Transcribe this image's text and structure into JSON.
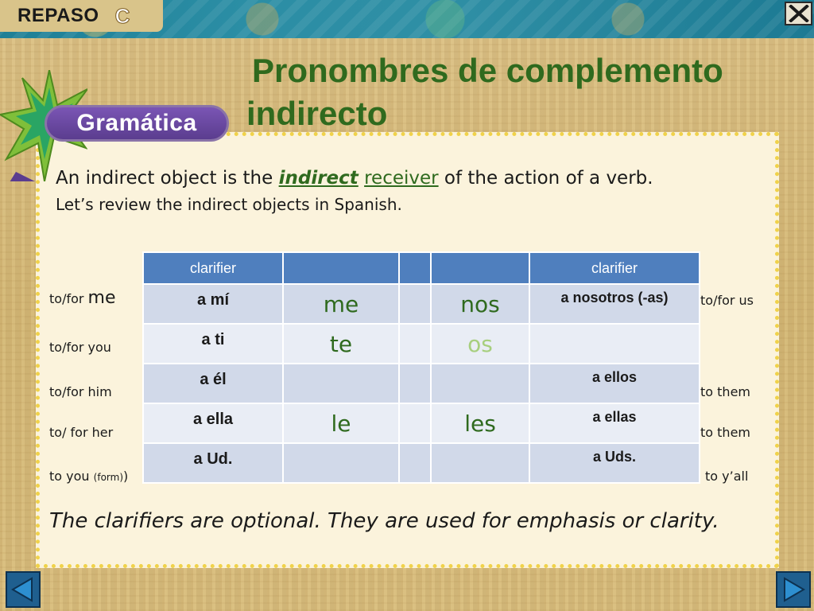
{
  "banner": {
    "label": "REPASO",
    "letter": "C",
    "close_icon": "close-x-icon"
  },
  "title": {
    "line1": "Pronombres de complemento",
    "line2": "indirecto"
  },
  "badge": {
    "label": "Gramática",
    "icon": "green-star-icon"
  },
  "intro": {
    "part1": "An indirect object is the ",
    "em1": "indirect",
    "em2": "receiver",
    "part2": " of the action of a verb.",
    "line2": "Let’s review the indirect objects in Spanish."
  },
  "left_labels": [
    {
      "prefix": "to/for ",
      "word": "me"
    },
    {
      "prefix": "to/for ",
      "word": "you"
    },
    {
      "prefix": "to/for him",
      "word": ""
    },
    {
      "prefix": "to/ for her",
      "word": ""
    },
    {
      "prefix": "to ",
      "word": "you",
      "small": "(form)",
      "suffix": ")"
    }
  ],
  "right_labels": [
    "to/for us",
    "",
    "to them",
    "to them",
    "to y’all"
  ],
  "table": {
    "headers": [
      "clarifier",
      "",
      "",
      "",
      "clarifier"
    ],
    "rows": [
      {
        "left": "a mí",
        "sing": "me",
        "plur": "nos",
        "right": "a nosotros (-as)"
      },
      {
        "left": "a ti",
        "sing": "te",
        "plur": "os",
        "right": ""
      },
      {
        "left": "a él",
        "sing": "",
        "plur": "",
        "right": "a ellos"
      },
      {
        "left": "a ella",
        "sing": "le",
        "plur": "les",
        "right": "a ellas"
      },
      {
        "left": "a Ud.",
        "sing": "",
        "plur": "",
        "right": "a Uds."
      }
    ]
  },
  "footer": "The  clarifiers are optional.  They are used for emphasis or clarity.",
  "nav": {
    "prev_icon": "triangle-left-icon",
    "next_icon": "triangle-right-icon"
  },
  "colors": {
    "title_green": "#2f6a1e",
    "header_blue": "#4f7fbe",
    "badge_purple": "#5b3d8f",
    "panel_border": "#f0d24a",
    "faded_green": "#a7cf7e"
  }
}
